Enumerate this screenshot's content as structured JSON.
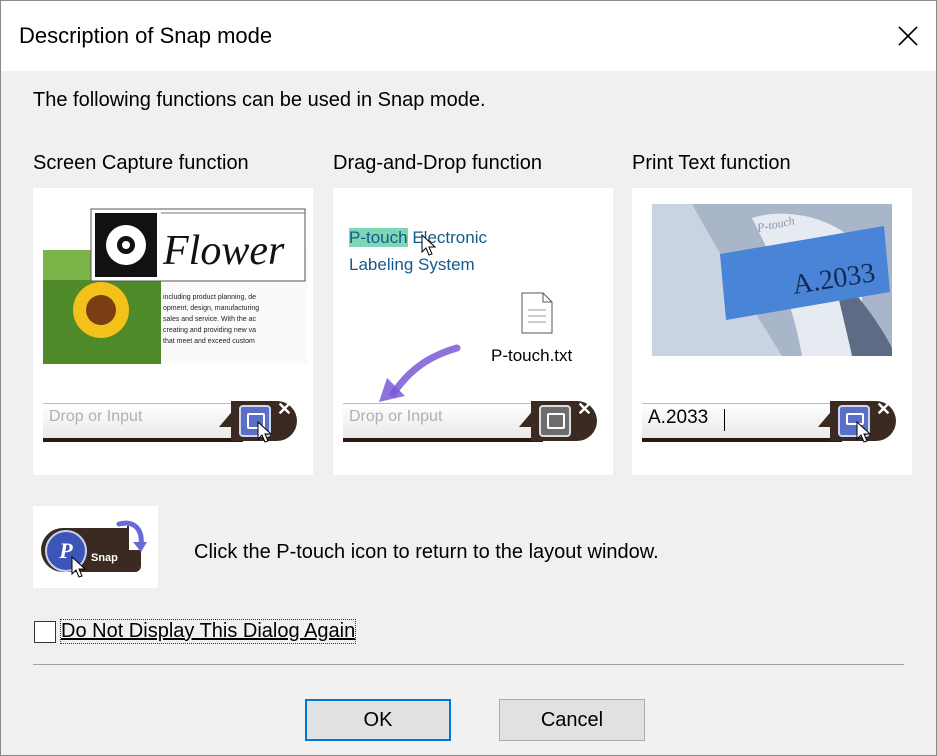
{
  "window": {
    "title": "Description of Snap mode",
    "close_icon": "close-icon"
  },
  "intro": "The following functions can be used in Snap mode.",
  "columns": [
    {
      "label": "Screen Capture function",
      "flower_word": "Flower",
      "body_lines": [
        "including product planning, de",
        "opment, design, manufacturing",
        "sales and service. With the ac",
        "creating and providing new va",
        "that meet and exceed custom"
      ],
      "bar_placeholder": "Drop or Input"
    },
    {
      "label": "Drag-and-Drop function",
      "highlight": "P-touch",
      "line1_rest": "Electronic",
      "line2": "Labeling System",
      "file_name": "P-touch.txt",
      "bar_placeholder": "Drop or Input"
    },
    {
      "label": "Print Text function",
      "tape_text": "A.2033",
      "brand_text": "P-touch",
      "bar_value": "A.2033"
    }
  ],
  "snap_badge": "Snap",
  "return_text": "Click the P-touch icon to return to the layout window.",
  "dont_show": {
    "label": "Do Not Display This Dialog Again",
    "checked": false
  },
  "buttons": {
    "ok": "OK",
    "cancel": "Cancel"
  },
  "colors": {
    "accent": "#0078d7",
    "highlight": "#7fd6b4",
    "snap_button": "#5a70c8",
    "bar_dark": "#3a2a22",
    "arrow": "#7a5ad6"
  }
}
